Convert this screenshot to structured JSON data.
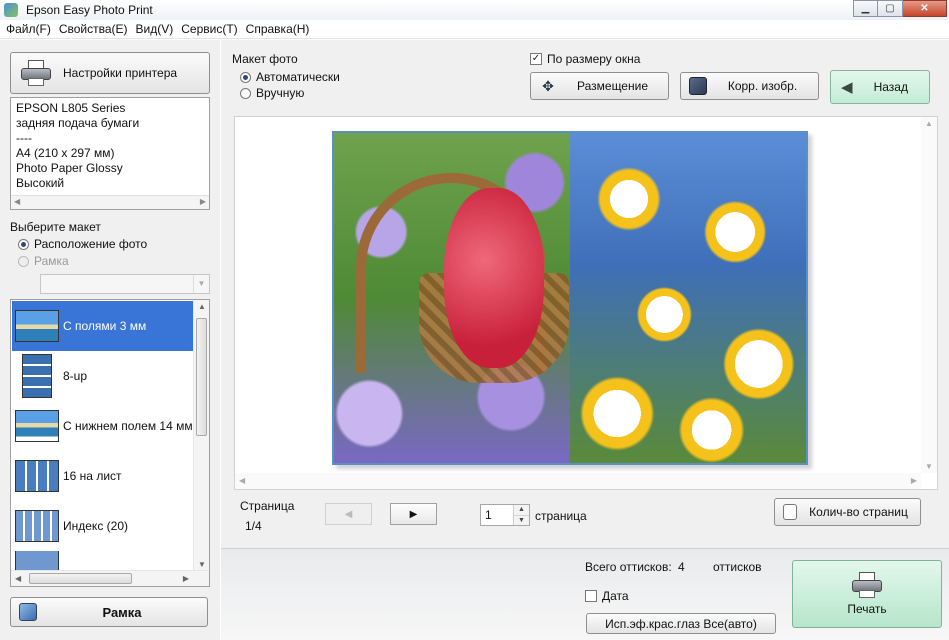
{
  "window": {
    "title": "Epson Easy Photo Print"
  },
  "menu": [
    "Файл(F)",
    "Свойства(E)",
    "Вид(V)",
    "Сервис(T)",
    "Справка(H)"
  ],
  "left": {
    "printer_settings_label": "Настройки принтера",
    "printer_info": [
      "EPSON L805 Series",
      "задняя подача бумаги",
      "----",
      "A4 (210 x 297 мм)",
      "Photo Paper Glossy",
      "Высокий"
    ],
    "select_layout_label": "Выберите макет",
    "radio_photo_layout": "Расположение фото",
    "radio_frame": "Рамка",
    "layouts": [
      {
        "label": "С полями 3 мм",
        "selected": true
      },
      {
        "label": "8-up",
        "selected": false
      },
      {
        "label": "С нижнем полем 14 мм",
        "selected": false
      },
      {
        "label": "16 на лист",
        "selected": false
      },
      {
        "label": "Индекс (20)",
        "selected": false
      }
    ],
    "frame_button_label": "Рамка"
  },
  "main": {
    "photo_layout_label": "Макет фото",
    "radio_auto": "Автоматически",
    "radio_manual": "Вручную",
    "fit_window_label": "По размеру окна",
    "fit_window_checked": true,
    "placement_label": "Размещение",
    "correct_label": "Корр. изобр.",
    "back_label": "Назад",
    "page_label": "Страница",
    "page_value": "1/4",
    "page_number": "1",
    "page_suffix": "страница",
    "copies_label": "Колич-во страниц"
  },
  "bottom": {
    "total_prints_label": "Всего оттисков:",
    "total_prints_value": "4",
    "total_prints_unit": "оттисков",
    "date_label": "Дата",
    "redeye_label": "Исп.эф.крас.глаз Все(авто)",
    "print_label": "Печать"
  },
  "colors": {
    "selection": "#3875d7",
    "back_button": "#c3ecd4",
    "print_button": "#b6e6ca",
    "photo_border": "#5b8fc7"
  }
}
